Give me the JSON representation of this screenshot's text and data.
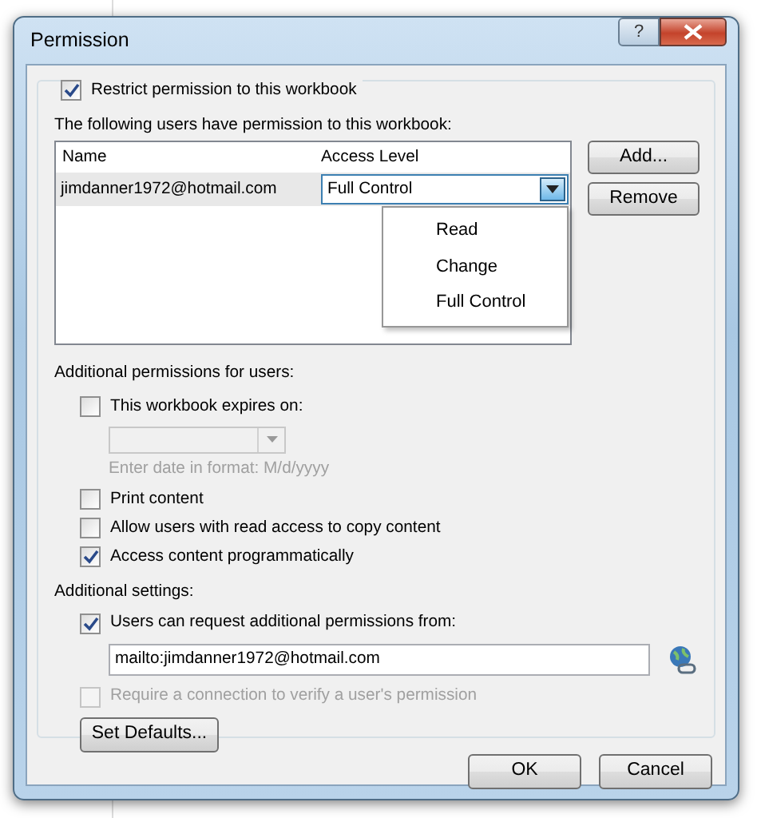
{
  "window": {
    "title": "Permission",
    "help_button": "?"
  },
  "restrict": {
    "label": "Restrict permission to this workbook",
    "checked": true
  },
  "users_label": "The following users have permission to this workbook:",
  "users_table": {
    "columns": [
      "Name",
      "Access Level"
    ],
    "rows": [
      {
        "name": "jimdanner1972@hotmail.com",
        "access_level": "Full Control",
        "expanded": true
      }
    ],
    "dropdown_options": [
      "Read",
      "Change",
      "Full Control"
    ]
  },
  "side_buttons": [
    "Add...",
    "Remove"
  ],
  "additional_permissions": {
    "label": "Additional permissions for users:",
    "expires": {
      "label": "This workbook expires on:",
      "checked": false
    },
    "date_field": {
      "disabled": true
    },
    "date_hint": "Enter date in format: M/d/yyyy",
    "options": [
      {
        "label": "Print content",
        "checked": false
      },
      {
        "label": "Allow users with read access to copy content",
        "checked": false
      },
      {
        "label": "Access content programmatically",
        "checked": true
      }
    ]
  },
  "additional_settings": {
    "label": "Additional settings:",
    "request": {
      "label": "Users can request additional permissions from:",
      "checked": true
    },
    "request_address": "mailto:jimdanner1972@hotmail.com",
    "require_connection": {
      "label": "Require a connection to verify a user's permission",
      "checked": false,
      "disabled": true
    },
    "set_defaults": "Set Defaults..."
  },
  "footer_buttons": [
    "OK",
    "Cancel"
  ]
}
